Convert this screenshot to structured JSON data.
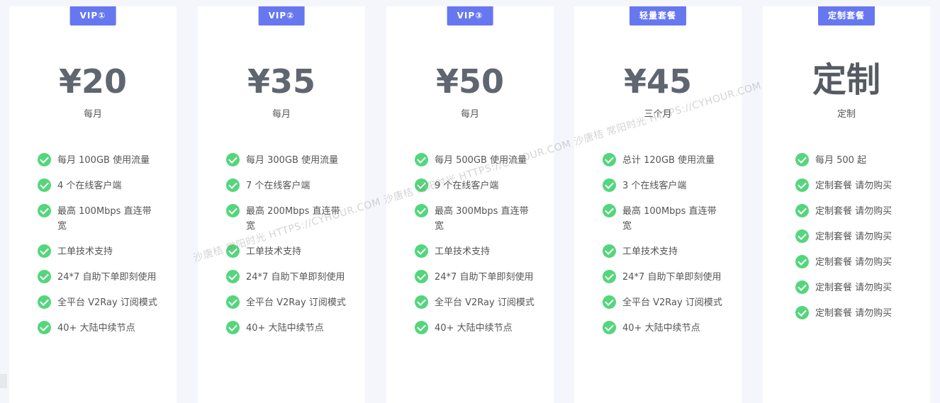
{
  "plans": [
    {
      "badge": "VIP①",
      "price": "¥20",
      "period": "每月",
      "features": [
        "每月 100GB 使用流量",
        "4 个在线客户端",
        "最高 100Mbps 直连带宽",
        "工单技术支持",
        "24*7 自助下单即刻使用",
        "全平台 V2Ray 订阅模式",
        "40+ 大陆中续节点"
      ]
    },
    {
      "badge": "VIP②",
      "price": "¥35",
      "period": "每月",
      "features": [
        "每月 300GB 使用流量",
        "7 个在线客户端",
        "最高 200Mbps 直连带宽",
        "工单技术支持",
        "24*7 自助下单即刻使用",
        "全平台 V2Ray 订阅模式",
        "40+ 大陆中续节点"
      ]
    },
    {
      "badge": "VIP③",
      "price": "¥50",
      "period": "每月",
      "features": [
        "每月 500GB 使用流量",
        "9 个在线客户端",
        "最高 300Mbps 直连带宽",
        "工单技术支持",
        "24*7 自助下单即刻使用",
        "全平台 V2Ray 订阅模式",
        "40+ 大陆中续节点"
      ]
    },
    {
      "badge": "轻量套餐",
      "price": "¥45",
      "period": "三个月",
      "features": [
        "总计 120GB 使用流量",
        "3 个在线客户端",
        "最高 100Mbps 直连带宽",
        "工单技术支持",
        "24*7 自助下单即刻使用",
        "全平台 V2Ray 订阅模式",
        "40+ 大陆中续节点"
      ]
    },
    {
      "badge": "定制套餐",
      "price": "定制",
      "period": "定制",
      "features": [
        "每月 500 起",
        "定制套餐 请勿购买",
        "定制套餐 请勿购买",
        "定制套餐 请勿购买",
        "定制套餐 请勿购买",
        "定制套餐 请勿购买",
        "定制套餐 请勿购买"
      ]
    }
  ],
  "watermark": "沙唐桔 常阳时光 HTTPS://CYHOUR.COM  沙唐桔 常阳时光 HTTPS://CYHOUR.COM  沙唐桔 常阳时光 HTTPS://CYHOUR.COM",
  "icons": {
    "feature": "check-circle-icon"
  },
  "colors": {
    "badge": "#6777ef",
    "check": "#54d67c",
    "price": "#5f6670",
    "background": "#f4f6fb"
  }
}
